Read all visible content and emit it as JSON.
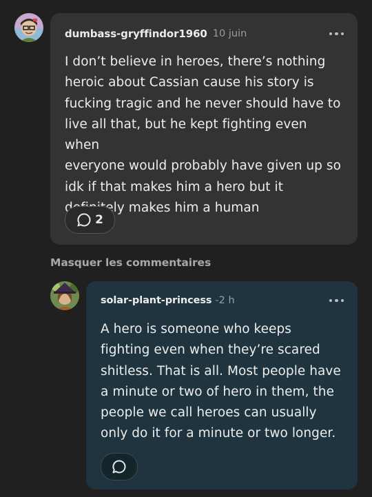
{
  "comments": [
    {
      "username": "dumbass-gryffindor1960",
      "time": "10 juin",
      "body": "I don’t believe in heroes, there’s nothing\nheroic about Cassian cause his story is\nfucking tragic and he never should have to\nlive all that, but he kept fighting even when\neveryone would probably have given up so\nidk if that makes him a hero but it\ndefinitely makes him a human",
      "reply_count": "2",
      "avatar_icon": "user-avatar-icon",
      "more_icon": "more-options-icon"
    }
  ],
  "hide_comments_label": "Masquer les commentaires",
  "replies": [
    {
      "username": "solar-plant-princess",
      "time": "-2 h",
      "body": "A hero is someone who keeps\nfighting even when they’re scared\nshitless. That is all. Most people have\na minute or two of hero in them, the\npeople we call heroes can usually\nonly do it for a minute or two longer.",
      "reply_count": "",
      "avatar_icon": "user-avatar-icon",
      "more_icon": "more-options-icon"
    }
  ],
  "colors": {
    "background": "#202020",
    "comment_card": "#333333",
    "reply_card": "#1f343e",
    "muted_text": "#9c9c9c"
  }
}
